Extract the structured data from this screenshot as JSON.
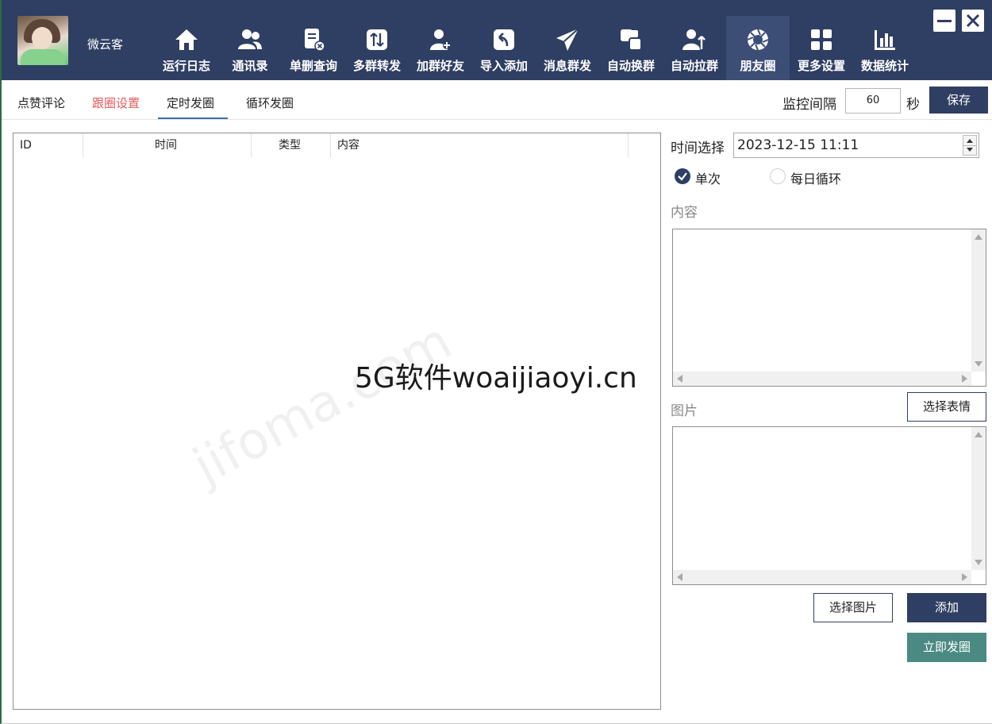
{
  "user": {
    "name": "微云客"
  },
  "nav": [
    {
      "label": "运行日志",
      "icon": "home-icon"
    },
    {
      "label": "通讯录",
      "icon": "contacts-icon"
    },
    {
      "label": "单删查询",
      "icon": "delete-check-icon"
    },
    {
      "label": "多群转发",
      "icon": "transfer-icon"
    },
    {
      "label": "加群好友",
      "icon": "add-friend-icon"
    },
    {
      "label": "导入添加",
      "icon": "import-icon"
    },
    {
      "label": "消息群发",
      "icon": "send-icon"
    },
    {
      "label": "自动换群",
      "icon": "switch-group-icon"
    },
    {
      "label": "自动拉群",
      "icon": "pull-group-icon"
    },
    {
      "label": "朋友圈",
      "icon": "moments-icon",
      "active": true
    },
    {
      "label": "更多设置",
      "icon": "grid-settings-icon"
    },
    {
      "label": "数据统计",
      "icon": "bar-chart-icon"
    }
  ],
  "tabs": [
    {
      "label": "点赞评论"
    },
    {
      "label": "跟圈设置"
    },
    {
      "label": "定时发圈",
      "active": true
    },
    {
      "label": "循环发圈"
    }
  ],
  "monitor": {
    "label": "监控间隔",
    "value": "60",
    "unit": "秒",
    "save_label": "保存"
  },
  "table": {
    "headers": [
      "ID",
      "时间",
      "类型",
      "内容"
    ],
    "rows": []
  },
  "form": {
    "time_label": "时间选择",
    "time_value": "2023-12-15 11:11",
    "radio_once": "单次",
    "radio_daily": "每日循环",
    "content_label": "内容",
    "image_label": "图片",
    "emoji_button": "选择表情",
    "choose_image_button": "选择图片",
    "add_button": "添加",
    "post_now_button": "立即发圈"
  },
  "watermark": {
    "text": "5G软件woaijiaoyi.cn",
    "faint": "jifoma.com"
  },
  "colors": {
    "header": "#2f3e63",
    "active_nav": "#3c4d76",
    "teal": "#4b8a83",
    "tab_red": "#e35b5b",
    "tab_underline": "#3a6db3"
  }
}
